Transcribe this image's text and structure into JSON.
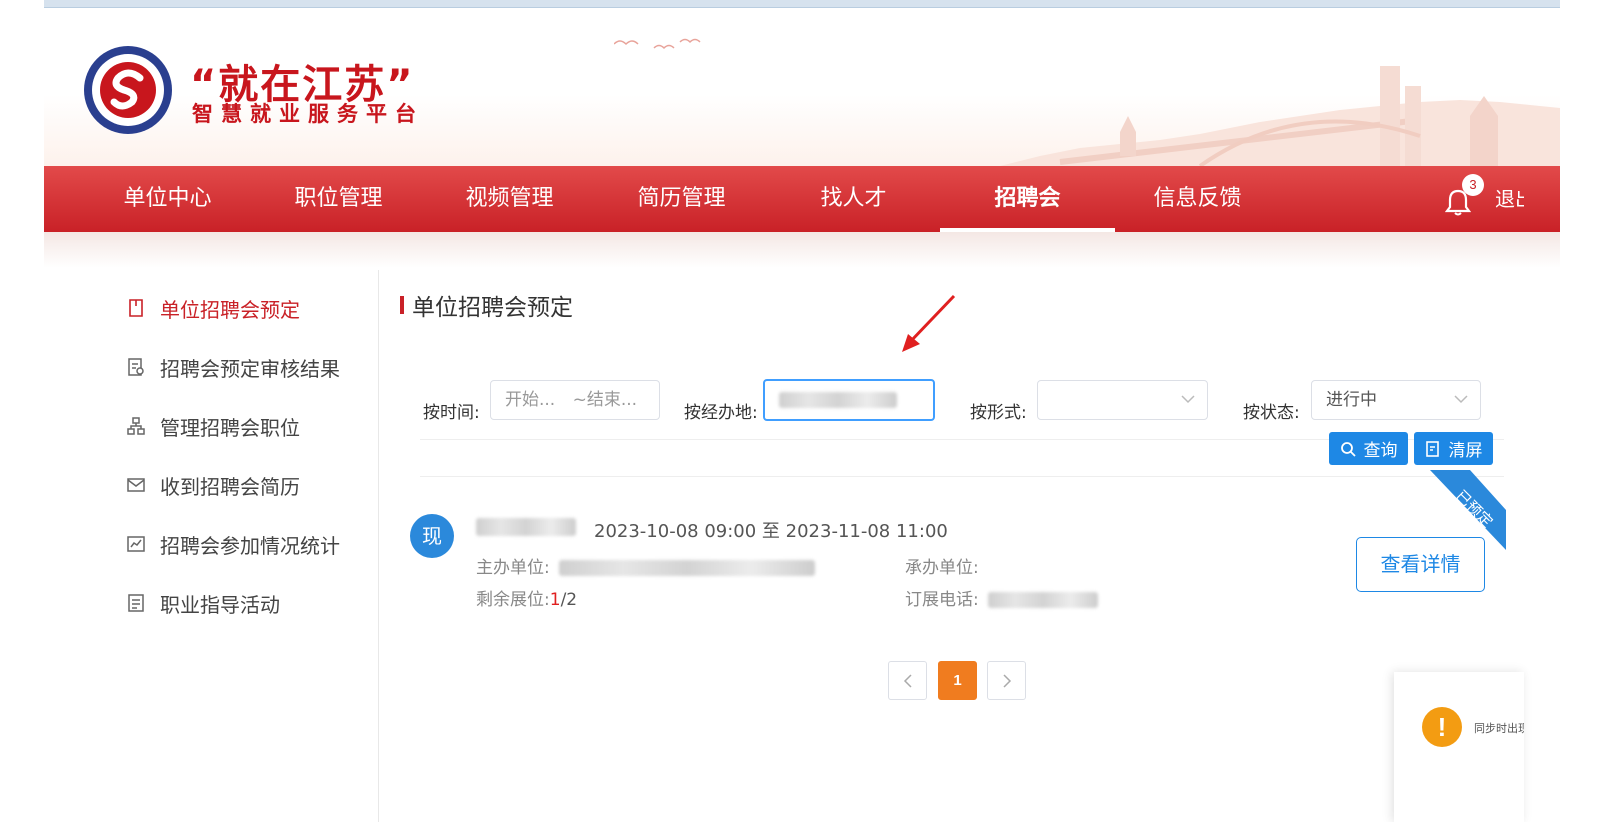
{
  "brand": {
    "title": "“就在江苏”",
    "subtitle": "智慧就业服务平台"
  },
  "nav": {
    "items": [
      {
        "label": "单位中心"
      },
      {
        "label": "职位管理"
      },
      {
        "label": "视频管理"
      },
      {
        "label": "简历管理"
      },
      {
        "label": "找人才"
      },
      {
        "label": "招聘会",
        "active": true
      },
      {
        "label": "信息反馈"
      }
    ],
    "notification_count": "3",
    "logout_label": "退出"
  },
  "sidebar": {
    "items": [
      {
        "label": "单位招聘会预定",
        "icon": "bookmark-icon",
        "active": true
      },
      {
        "label": "招聘会预定审核结果",
        "icon": "audit-icon"
      },
      {
        "label": "管理招聘会职位",
        "icon": "org-chart-icon"
      },
      {
        "label": "收到招聘会简历",
        "icon": "mail-icon"
      },
      {
        "label": "招聘会参加情况统计",
        "icon": "line-chart-icon"
      },
      {
        "label": "职业指导活动",
        "icon": "document-icon"
      }
    ]
  },
  "main": {
    "title": "单位招聘会预定",
    "filters": {
      "time_label": "按时间:",
      "start_placeholder": "开始...",
      "end_placeholder": "~结束...",
      "location_label": "按经办地:",
      "form_label": "按形式:",
      "status_label": "按状态:",
      "status_value": "进行中"
    },
    "buttons": {
      "query": "查询",
      "clear": "清屏"
    },
    "fair": {
      "avatar_char": "现",
      "time_range": "2023-10-08 09:00 至 2023-11-08 11:00",
      "host_label": "主办单位:",
      "organizer_label": "承办单位:",
      "remaining_label": "剩余展位:",
      "remaining_value": "1",
      "remaining_total": "/2",
      "phone_label": "订展电话:",
      "ribbon_label": "已预定",
      "detail_button": "查看详情"
    },
    "pagination": {
      "current": "1"
    }
  },
  "toast": {
    "text": "同步时出现"
  },
  "colors": {
    "nav_red": "#c92127",
    "accent_blue": "#1e88e5",
    "page_orange": "#f07c1f",
    "warning": "#f39c12"
  }
}
